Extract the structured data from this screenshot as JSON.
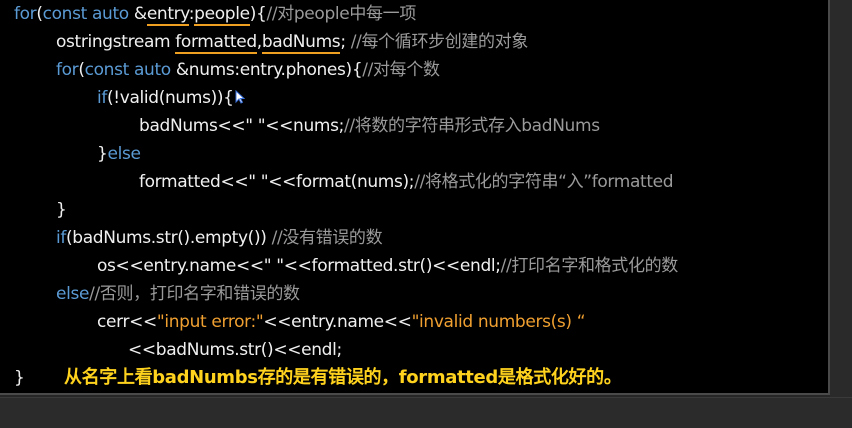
{
  "code": {
    "l1": {
      "kw1": "for",
      "a": "(",
      "kw2": "const auto",
      "b": " &",
      "entry": "entry",
      "colon": ":",
      "people": "people",
      "c": "){",
      "cm": "//对people中每一项"
    },
    "l2": {
      "a": "ostringstream ",
      "formatted": "formatted",
      "comma": ",",
      "badnums": "badNums",
      "semi": ";",
      "cm": " //每个循环步创建的对象"
    },
    "l3": {
      "kw1": "for",
      "a": "(",
      "kw2": "const auto",
      "b": " &nums:entry.phones){",
      "cm": "//对每个数"
    },
    "l4": {
      "kw": "if",
      "a": "(!valid(nums)){"
    },
    "l5": {
      "a": "badNums<<\" \"<<nums;",
      "cm": "//将数的字符串形式存入badNums"
    },
    "l6": {
      "a": "}",
      "kw": "else"
    },
    "l7": {
      "a": "formatted<<\" \"<<format(nums);",
      "cm": "//将格式化的字符串“入”formatted"
    },
    "l8": {
      "a": "}"
    },
    "l9": {
      "kw": "if",
      "a": "(badNums.str().empty()) ",
      "cm": "//没有错误的数"
    },
    "l10": {
      "a": "os<<entry.name<<\" \"<<formatted.str()<<endl;",
      "cm": "//打印名字和格式化的数"
    },
    "l11": {
      "kw": "else",
      "cm": "//否则，打印名字和错误的数"
    },
    "l12": {
      "a": "cerr<<",
      "s1": "\"input error:\"",
      "b": "<<entry.name<<",
      "s2": "\"invalid numbers(s) “"
    },
    "l13": {
      "a": "<<badNums.str()<<endl;"
    },
    "l14": {
      "a": "}"
    }
  },
  "annotation": {
    "text": "从名字上看badNumbs存的是有错误的，formatted是格式化好的。",
    "color": "#ffd21e"
  },
  "colors": {
    "keyword": "#5b9bd5",
    "comment": "#9a9a9a",
    "string": "#f0a030",
    "underline": "#f0a020"
  },
  "icons": {
    "cursor": "mouse-pointer-icon"
  }
}
